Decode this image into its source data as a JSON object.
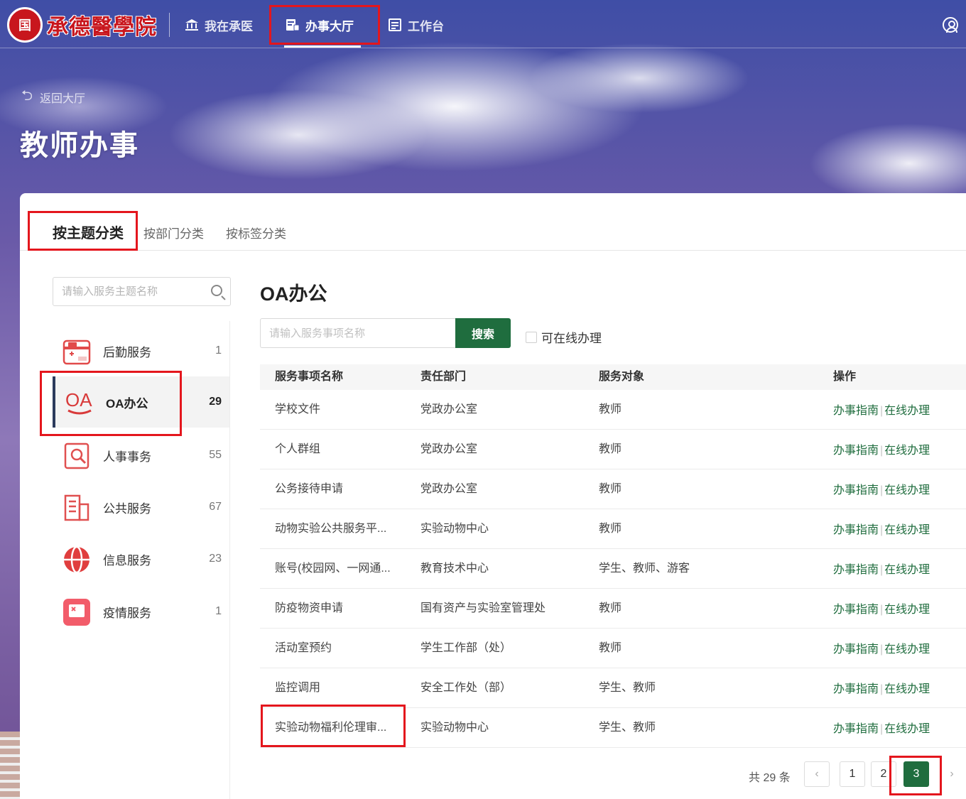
{
  "header": {
    "logo_seal": "国",
    "logo_text": "承德醫學院",
    "nav": [
      {
        "label": "我在承医",
        "icon": "bank-icon"
      },
      {
        "label": "办事大厅",
        "icon": "service-hall-icon"
      },
      {
        "label": "工作台",
        "icon": "workbench-icon"
      }
    ],
    "active_nav": "办事大厅"
  },
  "hero": {
    "back_label": "返回大厅",
    "title": "教师办事"
  },
  "tabs": [
    "按主题分类",
    "按部门分类",
    "按标签分类"
  ],
  "active_tab": "按主题分类",
  "sidebar": {
    "search_placeholder": "请输入服务主题名称",
    "categories": [
      {
        "label": "后勤服务",
        "count": "1",
        "icon": "logistics-icon"
      },
      {
        "label": "OA办公",
        "count": "29",
        "icon": "oa-icon"
      },
      {
        "label": "人事事务",
        "count": "55",
        "icon": "personnel-icon"
      },
      {
        "label": "公共服务",
        "count": "67",
        "icon": "public-service-icon"
      },
      {
        "label": "信息服务",
        "count": "23",
        "icon": "globe-icon"
      },
      {
        "label": "疫情服务",
        "count": "1",
        "icon": "epidemic-icon"
      }
    ],
    "active_category": "OA办公"
  },
  "main": {
    "title": "OA办公",
    "search_placeholder": "请输入服务事项名称",
    "search_button": "搜索",
    "online_filter_label": "可在线办理",
    "accent_color": "#1f6d3e",
    "columns": [
      "服务事项名称",
      "责任部门",
      "服务对象",
      "操作"
    ],
    "rows": [
      {
        "name": "学校文件",
        "dept": "党政办公室",
        "target": "教师"
      },
      {
        "name": "个人群组",
        "dept": "党政办公室",
        "target": "教师"
      },
      {
        "name": "公务接待申请",
        "dept": "党政办公室",
        "target": "教师"
      },
      {
        "name": "动物实验公共服务平...",
        "dept": "实验动物中心",
        "target": "教师"
      },
      {
        "name": "账号(校园网、一网通...",
        "dept": "教育技术中心",
        "target": "学生、教师、游客"
      },
      {
        "name": "防疫物资申请",
        "dept": "国有资产与实验室管理处",
        "target": "教师"
      },
      {
        "name": "活动室预约",
        "dept": "学生工作部（处）",
        "target": "教师"
      },
      {
        "name": "监控调用",
        "dept": "安全工作处（部）",
        "target": "学生、教师"
      },
      {
        "name": "实验动物福利伦理审...",
        "dept": "实验动物中心",
        "target": "学生、教师"
      }
    ],
    "action_guide": "办事指南",
    "action_online": "在线办理",
    "action_separator": "|"
  },
  "pagination": {
    "total": "共 29 条",
    "pages": [
      "1",
      "2",
      "3"
    ],
    "current": "3",
    "prev": "‹",
    "next": "›"
  },
  "highlight_color": "#e4161d"
}
